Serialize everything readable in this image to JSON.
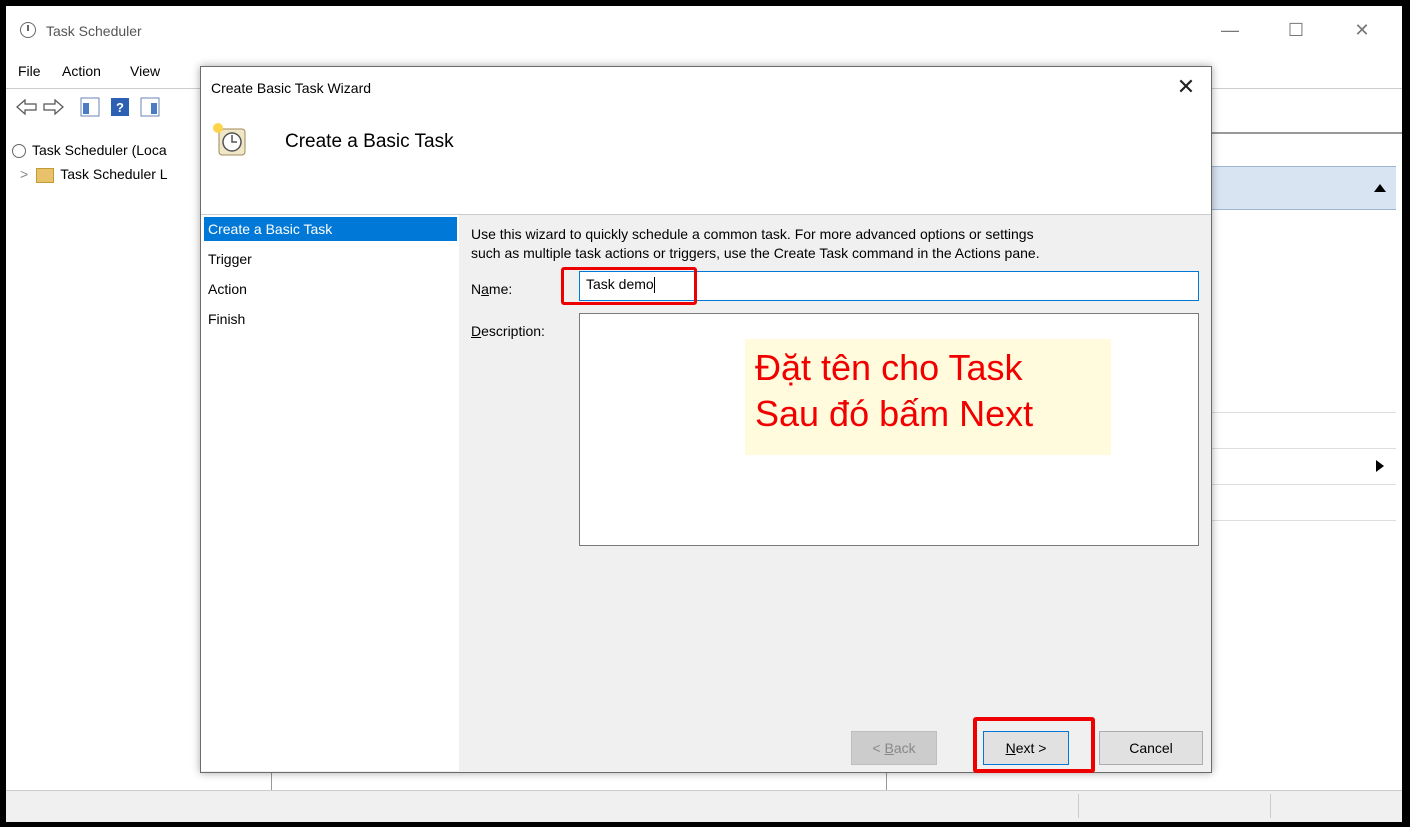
{
  "window": {
    "title": "Task Scheduler",
    "controls": {
      "minimize": "—",
      "maximize": "☐",
      "close": "✕"
    }
  },
  "menu": {
    "items": [
      "File",
      "Action",
      "View"
    ]
  },
  "tree": {
    "root_label": "Task Scheduler (Loca",
    "child_label": "Task Scheduler L",
    "expander": ">"
  },
  "dialog": {
    "title": "Create Basic Task Wizard",
    "close": "✕",
    "header_title": "Create a Basic Task",
    "steps": [
      "Create a Basic Task",
      "Trigger",
      "Action",
      "Finish"
    ],
    "intro_line1": "Use this wizard to quickly schedule a common task.  For more advanced options or settings",
    "intro_line2": "such as multiple task actions or triggers, use the Create Task command in the Actions pane.",
    "name_label_pre": "N",
    "name_label_u": "a",
    "name_label_post": "me:",
    "name_value": "Task demo",
    "desc_label_u": "D",
    "desc_label_post": "escription:",
    "back_pre": "< ",
    "back_u": "B",
    "back_post": "ack",
    "next_u": "N",
    "next_post": "ext >",
    "cancel_label": "Cancel"
  },
  "annotation": {
    "line1": "Đặt tên cho Task",
    "line2": "Sau đó bấm Next"
  },
  "colors": {
    "accent": "#0078d7",
    "highlight": "#ee0000",
    "note_bg": "#fffbdc"
  }
}
